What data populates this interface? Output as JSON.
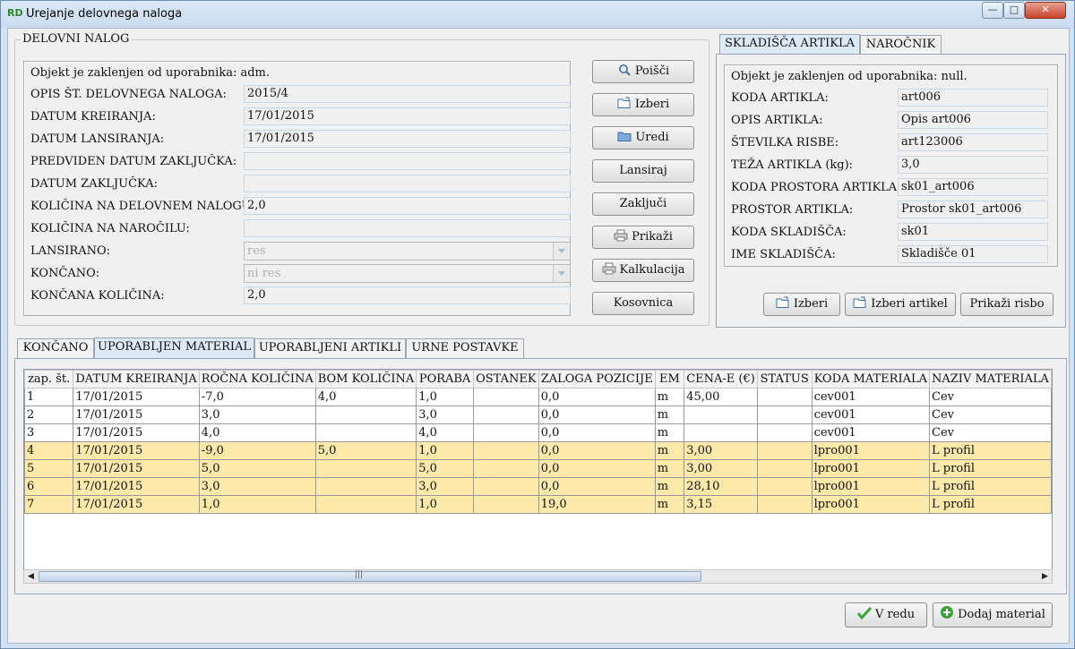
{
  "window": {
    "title": "Urejanje delovnega naloga",
    "icon": "app-logo-icon",
    "minimize": "—",
    "maximize": "□",
    "close": "✕"
  },
  "delovni_nalog": {
    "group_title": "DELOVNI NALOG",
    "lock_text": "Objekt je zaklenjen od uporabnika: adm.",
    "fields": [
      {
        "label": "OPIS ŠT. DELOVNEGA NALOGA:",
        "value": "2015/4"
      },
      {
        "label": "DATUM KREIRANJA:",
        "value": "17/01/2015"
      },
      {
        "label": "DATUM LANSIRANJA:",
        "value": "17/01/2015"
      },
      {
        "label": "PREDVIDEN DATUM ZAKLJUČKA:",
        "value": ""
      },
      {
        "label": "DATUM ZAKLJUČKA:",
        "value": ""
      },
      {
        "label": "KOLIČINA NA DELOVNEM NALOGU:",
        "value": "2,0"
      },
      {
        "label": "KOLIČINA NA NAROČILU:",
        "value": ""
      },
      {
        "label": "LANSIRANO:",
        "value": "res"
      },
      {
        "label": "KONČANO:",
        "value": "ni res"
      },
      {
        "label": "KONČANA KOLIČINA:",
        "value": "2,0"
      }
    ]
  },
  "side_buttons": [
    {
      "label": "Poišči",
      "icon": "search-icon"
    },
    {
      "label": "Izberi",
      "icon": "folder-open-icon"
    },
    {
      "label": "Uredi",
      "icon": "folder-icon"
    },
    {
      "label": "Lansiraj",
      "icon": ""
    },
    {
      "label": "Zaključi",
      "icon": ""
    },
    {
      "label": "Prikaži",
      "icon": "printer-icon"
    },
    {
      "label": "Kalkulacija",
      "icon": "printer-icon"
    },
    {
      "label": "Kosovnica",
      "icon": ""
    }
  ],
  "right_panel": {
    "tabs": [
      "SKLADIŠČA ARTIKLA",
      "NAROČNIK"
    ],
    "lock_text": "Objekt je zaklenjen od uporabnika: null.",
    "fields": [
      {
        "label": "KODA ARTIKLA:",
        "value": "art006"
      },
      {
        "label": "OPIS ARTIKLA:",
        "value": "Opis art006"
      },
      {
        "label": "ŠTEVILKA RISBE:",
        "value": "art123006"
      },
      {
        "label": "TEŽA ARTIKLA (kg):",
        "value": "3,0"
      },
      {
        "label": "KODA PROSTORA ARTIKLA:",
        "value": "sk01_art006"
      },
      {
        "label": "PROSTOR ARTIKLA:",
        "value": "Prostor sk01_art006"
      },
      {
        "label": "KODA SKLADIŠČA:",
        "value": "sk01"
      },
      {
        "label": "IME SKLADIŠČA:",
        "value": "Skladišče 01"
      }
    ],
    "buttons": [
      {
        "label": "Izberi",
        "icon": "folder-open-icon"
      },
      {
        "label": "Izberi artikel",
        "icon": "folder-open-icon"
      },
      {
        "label": "Prikaži risbo",
        "icon": ""
      }
    ]
  },
  "bottom_tabs": [
    "KONČANO",
    "UPORABLJEN MATERIAL",
    "UPORABLJENI ARTIKLI",
    "URNE POSTAVKE"
  ],
  "table": {
    "columns": [
      "zap. št.",
      "DATUM KREIRANJA",
      "ROČNA KOLIČINA",
      "BOM KOLIČINA",
      "PORABA",
      "OSTANEK",
      "ZALOGA POZICIJE",
      "EM",
      "CENA-E (€)",
      "STATUS",
      "KODA MATERIALA",
      "NAZIV MATERIALA"
    ],
    "rows": [
      [
        "1",
        "17/01/2015",
        "-7,0",
        "4,0",
        "1,0",
        "",
        "0,0",
        "m",
        "45,00",
        "",
        "cev001",
        "Cev"
      ],
      [
        "2",
        "17/01/2015",
        "3,0",
        "",
        "3,0",
        "",
        "0,0",
        "m",
        "",
        "",
        "cev001",
        "Cev"
      ],
      [
        "3",
        "17/01/2015",
        "4,0",
        "",
        "4,0",
        "",
        "0,0",
        "m",
        "",
        "",
        "cev001",
        "Cev"
      ],
      [
        "4",
        "17/01/2015",
        "-9,0",
        "5,0",
        "1,0",
        "",
        "0,0",
        "m",
        "3,00",
        "",
        "lpro001",
        "L profil"
      ],
      [
        "5",
        "17/01/2015",
        "5,0",
        "",
        "5,0",
        "",
        "0,0",
        "m",
        "3,00",
        "",
        "lpro001",
        "L profil"
      ],
      [
        "6",
        "17/01/2015",
        "3,0",
        "",
        "3,0",
        "",
        "0,0",
        "m",
        "28,10",
        "",
        "lpro001",
        "L profil"
      ],
      [
        "7",
        "17/01/2015",
        "1,0",
        "",
        "1,0",
        "",
        "19,0",
        "m",
        "3,15",
        "",
        "lpro001",
        "L profil"
      ]
    ],
    "highlighted_rows": [
      3,
      4,
      5,
      6
    ],
    "scroll_thumb_grip": "|||",
    "scroll_left": "◀",
    "scroll_right": "▶"
  },
  "footer": {
    "ok_label": "V redu",
    "ok_icon": "checkmark-icon",
    "add_label": "Dodaj material",
    "add_icon": "plus-circle-icon"
  },
  "colors": {
    "highlight_row": "#fde9a9",
    "window_chrome": "#d3e2f2",
    "close_button": "#c8432c"
  }
}
